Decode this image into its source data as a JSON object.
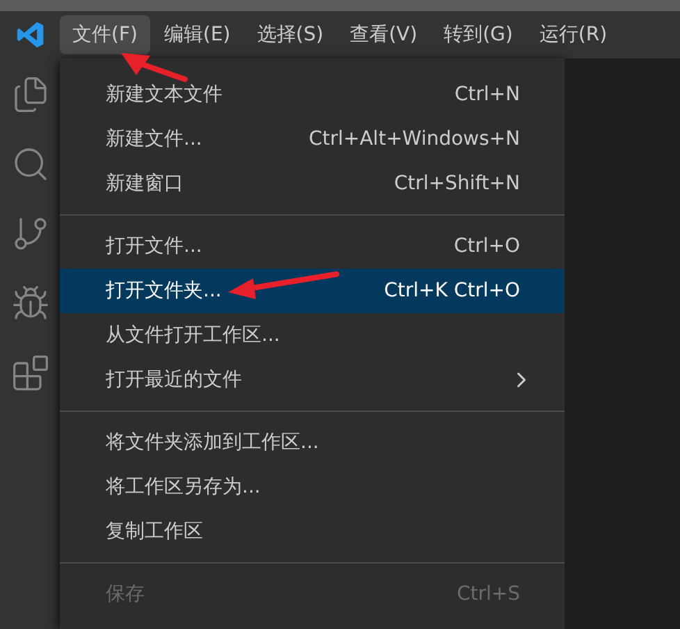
{
  "menu_bar": [
    {
      "label": "文件(F)",
      "selected": true
    },
    {
      "label": "编辑(E)",
      "selected": false
    },
    {
      "label": "选择(S)",
      "selected": false
    },
    {
      "label": "查看(V)",
      "selected": false
    },
    {
      "label": "转到(G)",
      "selected": false
    },
    {
      "label": "运行(R)",
      "selected": false
    }
  ],
  "activity_bar": [
    {
      "kind": "files"
    },
    {
      "kind": "search"
    },
    {
      "kind": "source-control"
    },
    {
      "kind": "run-debug"
    },
    {
      "kind": "extensions"
    }
  ],
  "file_menu": [
    {
      "kind": "item",
      "label": "新建文本文件",
      "shortcut": "Ctrl+N",
      "selected": false,
      "disabled": false
    },
    {
      "kind": "item",
      "label": "新建文件...",
      "shortcut": "Ctrl+Alt+Windows+N",
      "selected": false,
      "disabled": false
    },
    {
      "kind": "item",
      "label": "新建窗口",
      "shortcut": "Ctrl+Shift+N",
      "selected": false,
      "disabled": false
    },
    {
      "kind": "separator"
    },
    {
      "kind": "item",
      "label": "打开文件...",
      "shortcut": "Ctrl+O",
      "selected": false,
      "disabled": false
    },
    {
      "kind": "item",
      "label": "打开文件夹...",
      "shortcut": "Ctrl+K Ctrl+O",
      "selected": true,
      "disabled": false
    },
    {
      "kind": "item",
      "label": "从文件打开工作区...",
      "selected": false,
      "disabled": false
    },
    {
      "kind": "submenu",
      "label": "打开最近的文件",
      "selected": false,
      "disabled": false
    },
    {
      "kind": "separator"
    },
    {
      "kind": "item",
      "label": "将文件夹添加到工作区...",
      "selected": false,
      "disabled": false
    },
    {
      "kind": "item",
      "label": "将工作区另存为...",
      "selected": false,
      "disabled": false
    },
    {
      "kind": "item",
      "label": "复制工作区",
      "selected": false,
      "disabled": false
    },
    {
      "kind": "separator"
    },
    {
      "kind": "item",
      "label": "保存",
      "shortcut": "Ctrl+S",
      "selected": false,
      "disabled": true
    }
  ]
}
